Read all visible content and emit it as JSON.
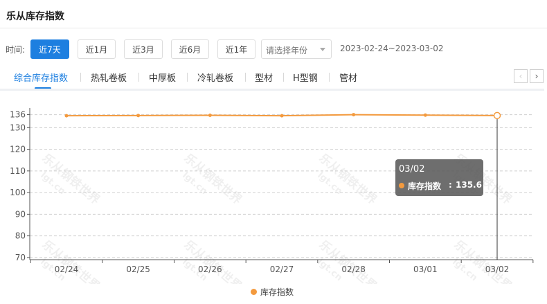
{
  "header": {
    "title": "乐从库存指数"
  },
  "filters": {
    "label": "时间:",
    "ranges": [
      "近7天",
      "近1月",
      "近3月",
      "近6月",
      "近1年"
    ],
    "active_range": "近7天",
    "year_placeholder": "请选择年份",
    "date_range": "2023-02-24~2023-03-02"
  },
  "tabs": {
    "items": [
      "综合库存指数",
      "热轧卷板",
      "中厚板",
      "冷轧卷板",
      "型材",
      "H型钢",
      "管材"
    ],
    "active": "综合库存指数",
    "prev_icon": "chevron-left-icon",
    "next_icon": "chevron-right-icon",
    "prev_glyph": "‹",
    "next_glyph": "›"
  },
  "watermark": {
    "text": "乐从钢铁世界",
    "url_text": "lgt.cn"
  },
  "chart_data": {
    "type": "line",
    "categories": [
      "02/24",
      "02/25",
      "02/26",
      "02/27",
      "02/28",
      "03/01",
      "03/02"
    ],
    "series": [
      {
        "name": "库存指数",
        "values": [
          135.5,
          135.6,
          135.7,
          135.5,
          136.0,
          135.8,
          135.6
        ],
        "color": "#f39a3e"
      }
    ],
    "y_ticks": [
      70,
      80,
      90,
      100,
      110,
      120,
      130,
      136
    ],
    "ylim": [
      69,
      136.5
    ],
    "grid": true,
    "legend_position": "bottom-center",
    "tooltip": {
      "category": "03/02",
      "series": "库存指数",
      "separator": ":",
      "value": "135.6"
    }
  }
}
